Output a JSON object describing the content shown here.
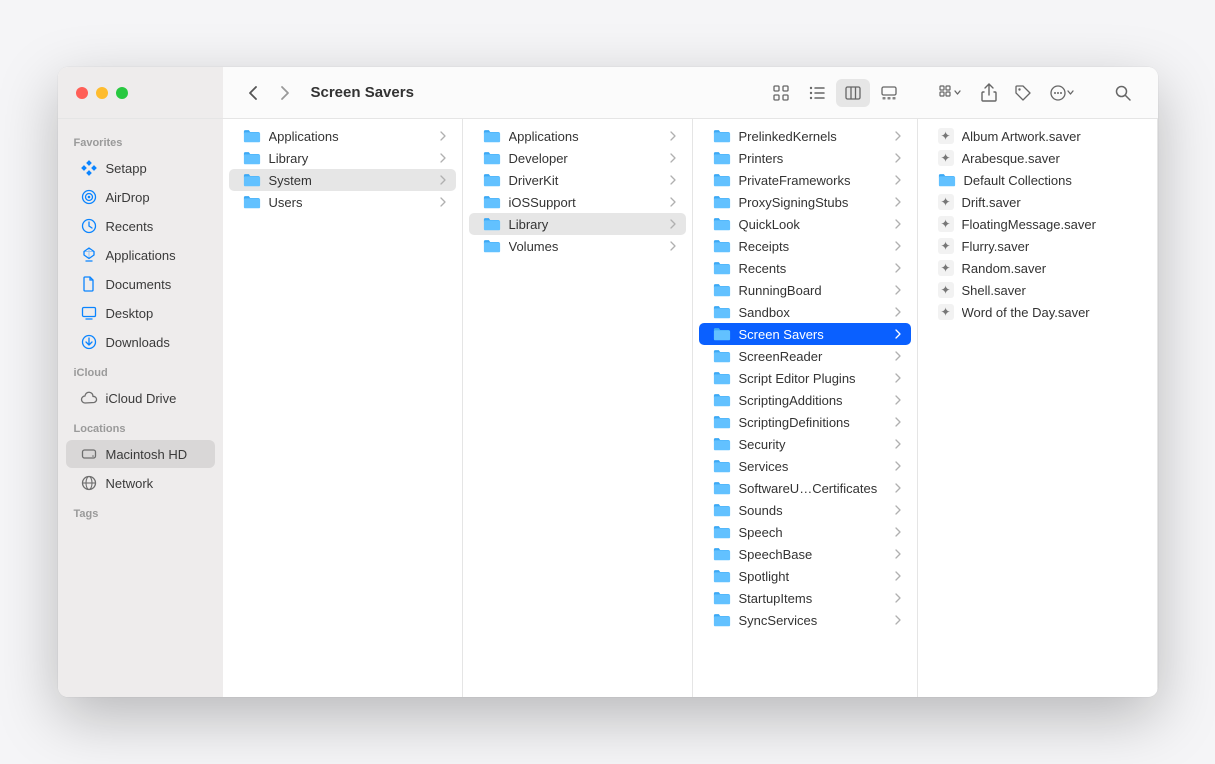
{
  "window_title": "Screen Savers",
  "sidebar": {
    "sections": [
      {
        "title": "Favorites",
        "items": [
          {
            "label": "Setapp",
            "icon": "setapp-icon",
            "selected": false,
            "color": "blue"
          },
          {
            "label": "AirDrop",
            "icon": "airdrop-icon",
            "selected": false,
            "color": "blue"
          },
          {
            "label": "Recents",
            "icon": "recents-icon",
            "selected": false,
            "color": "blue"
          },
          {
            "label": "Applications",
            "icon": "applications-icon",
            "selected": false,
            "color": "blue"
          },
          {
            "label": "Documents",
            "icon": "documents-icon",
            "selected": false,
            "color": "blue"
          },
          {
            "label": "Desktop",
            "icon": "desktop-icon",
            "selected": false,
            "color": "blue"
          },
          {
            "label": "Downloads",
            "icon": "downloads-icon",
            "selected": false,
            "color": "blue"
          }
        ]
      },
      {
        "title": "iCloud",
        "items": [
          {
            "label": "iCloud Drive",
            "icon": "icloud-icon",
            "selected": false,
            "color": "gray"
          }
        ]
      },
      {
        "title": "Locations",
        "items": [
          {
            "label": "Macintosh HD",
            "icon": "harddisk-icon",
            "selected": true,
            "color": "gray"
          },
          {
            "label": "Network",
            "icon": "network-icon",
            "selected": false,
            "color": "gray"
          }
        ]
      },
      {
        "title": "Tags",
        "items": []
      }
    ]
  },
  "columns": [
    {
      "items": [
        {
          "label": "Applications",
          "type": "folder",
          "hasChildren": true,
          "state": "none"
        },
        {
          "label": "Library",
          "type": "folder",
          "hasChildren": true,
          "state": "none"
        },
        {
          "label": "System",
          "type": "folder",
          "hasChildren": true,
          "state": "path"
        },
        {
          "label": "Users",
          "type": "folder",
          "hasChildren": true,
          "state": "none"
        }
      ]
    },
    {
      "items": [
        {
          "label": "Applications",
          "type": "folder",
          "hasChildren": true,
          "state": "none"
        },
        {
          "label": "Developer",
          "type": "folder",
          "hasChildren": true,
          "state": "none"
        },
        {
          "label": "DriverKit",
          "type": "folder",
          "hasChildren": true,
          "state": "none"
        },
        {
          "label": "iOSSupport",
          "type": "folder",
          "hasChildren": true,
          "state": "none"
        },
        {
          "label": "Library",
          "type": "folder",
          "hasChildren": true,
          "state": "path"
        },
        {
          "label": "Volumes",
          "type": "folder",
          "hasChildren": true,
          "state": "none"
        }
      ]
    },
    {
      "items": [
        {
          "label": "PrelinkedKernels",
          "type": "folder",
          "hasChildren": true,
          "state": "none"
        },
        {
          "label": "Printers",
          "type": "folder",
          "hasChildren": true,
          "state": "none"
        },
        {
          "label": "PrivateFrameworks",
          "type": "folder",
          "hasChildren": true,
          "state": "none"
        },
        {
          "label": "ProxySigningStubs",
          "type": "folder",
          "hasChildren": true,
          "state": "none"
        },
        {
          "label": "QuickLook",
          "type": "folder",
          "hasChildren": true,
          "state": "none"
        },
        {
          "label": "Receipts",
          "type": "folder",
          "hasChildren": true,
          "state": "none"
        },
        {
          "label": "Recents",
          "type": "folder",
          "hasChildren": true,
          "state": "none"
        },
        {
          "label": "RunningBoard",
          "type": "folder",
          "hasChildren": true,
          "state": "none"
        },
        {
          "label": "Sandbox",
          "type": "folder",
          "hasChildren": true,
          "state": "none"
        },
        {
          "label": "Screen Savers",
          "type": "folder",
          "hasChildren": true,
          "state": "selected"
        },
        {
          "label": "ScreenReader",
          "type": "folder",
          "hasChildren": true,
          "state": "none"
        },
        {
          "label": "Script Editor Plugins",
          "type": "folder",
          "hasChildren": true,
          "state": "none"
        },
        {
          "label": "ScriptingAdditions",
          "type": "folder",
          "hasChildren": true,
          "state": "none"
        },
        {
          "label": "ScriptingDefinitions",
          "type": "folder",
          "hasChildren": true,
          "state": "none"
        },
        {
          "label": "Security",
          "type": "folder",
          "hasChildren": true,
          "state": "none"
        },
        {
          "label": "Services",
          "type": "folder",
          "hasChildren": true,
          "state": "none"
        },
        {
          "label": "SoftwareU…Certificates",
          "type": "folder",
          "hasChildren": true,
          "state": "none"
        },
        {
          "label": "Sounds",
          "type": "folder",
          "hasChildren": true,
          "state": "none"
        },
        {
          "label": "Speech",
          "type": "folder",
          "hasChildren": true,
          "state": "none"
        },
        {
          "label": "SpeechBase",
          "type": "folder",
          "hasChildren": true,
          "state": "none"
        },
        {
          "label": "Spotlight",
          "type": "folder",
          "hasChildren": true,
          "state": "none"
        },
        {
          "label": "StartupItems",
          "type": "folder",
          "hasChildren": true,
          "state": "none"
        },
        {
          "label": "SyncServices",
          "type": "folder",
          "hasChildren": true,
          "state": "none"
        }
      ]
    },
    {
      "items": [
        {
          "label": "Album Artwork.saver",
          "type": "file",
          "hasChildren": false,
          "state": "none"
        },
        {
          "label": "Arabesque.saver",
          "type": "file",
          "hasChildren": false,
          "state": "none"
        },
        {
          "label": "Default Collections",
          "type": "folder",
          "hasChildren": false,
          "state": "none"
        },
        {
          "label": "Drift.saver",
          "type": "file",
          "hasChildren": false,
          "state": "none"
        },
        {
          "label": "FloatingMessage.saver",
          "type": "file",
          "hasChildren": false,
          "state": "none"
        },
        {
          "label": "Flurry.saver",
          "type": "file",
          "hasChildren": false,
          "state": "none"
        },
        {
          "label": "Random.saver",
          "type": "file",
          "hasChildren": false,
          "state": "none"
        },
        {
          "label": "Shell.saver",
          "type": "file",
          "hasChildren": false,
          "state": "none"
        },
        {
          "label": "Word of the Day.saver",
          "type": "file",
          "hasChildren": false,
          "state": "none"
        }
      ]
    }
  ]
}
